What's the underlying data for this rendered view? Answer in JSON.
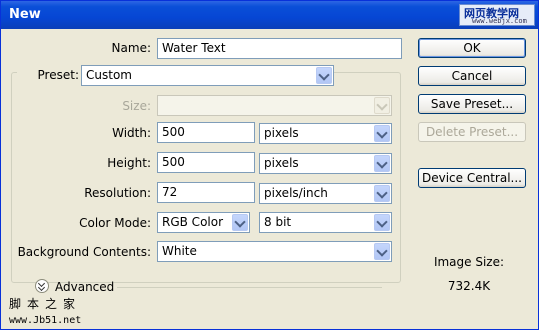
{
  "window": {
    "title": "New",
    "watermark_line1": "网页教学网",
    "watermark_line2": "www.webjx.com"
  },
  "form": {
    "name_label": "Name:",
    "name_value": "Water Text",
    "preset_label": "Preset:",
    "preset_value": "Custom",
    "size_label": "Size:",
    "size_value": "",
    "width_label": "Width:",
    "width_value": "500",
    "width_unit": "pixels",
    "height_label": "Height:",
    "height_value": "500",
    "height_unit": "pixels",
    "resolution_label": "Resolution:",
    "resolution_value": "72",
    "resolution_unit": "pixels/inch",
    "color_mode_label": "Color Mode:",
    "color_mode_value": "RGB Color",
    "bit_depth_value": "8 bit",
    "background_label": "Background Contents:",
    "background_value": "White",
    "advanced_label": "Advanced"
  },
  "buttons": {
    "ok": "OK",
    "cancel": "Cancel",
    "save_preset": "Save Preset...",
    "delete_preset": "Delete Preset...",
    "device_central": "Device Central..."
  },
  "image_size": {
    "label": "Image Size:",
    "value": "732.4K"
  },
  "watermark_bottom": {
    "line1": "脚本之家",
    "line2": "www.Jb51.net"
  },
  "colors": {
    "title_bar": "#0a4fd8",
    "dialog_bg": "#ece9d8",
    "field_border": "#7f9db9"
  }
}
